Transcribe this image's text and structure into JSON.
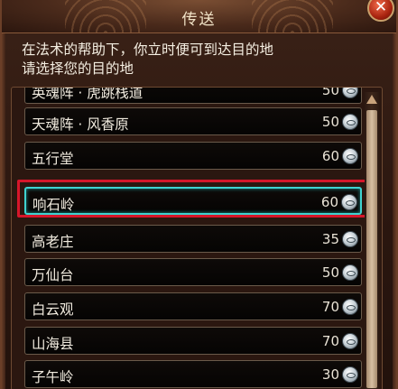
{
  "window": {
    "title": "传送",
    "close_icon": "close-x-icon"
  },
  "intro": {
    "line1": "在法术的帮助下，你立时便可到达目的地",
    "line2": "请选择您的目的地"
  },
  "destinations": [
    {
      "name": "英魂阵 · 虎跳栈道",
      "price": "50"
    },
    {
      "name": "天魂阵 · 风香原",
      "price": "50"
    },
    {
      "name": "五行堂",
      "price": "60"
    },
    {
      "name": "响石岭",
      "price": "60"
    },
    {
      "name": "高老庄",
      "price": "35"
    },
    {
      "name": "万仙台",
      "price": "50"
    },
    {
      "name": "白云观",
      "price": "70"
    },
    {
      "name": "山海县",
      "price": "70"
    },
    {
      "name": "子午岭",
      "price": "30"
    }
  ],
  "selected_index": 3,
  "colors": {
    "highlight": "#d6162a",
    "selected_border": "#3fd2d0"
  },
  "icons": {
    "price": "silver-coin-icon",
    "scroll": "scroll-up-arrow-icon"
  }
}
